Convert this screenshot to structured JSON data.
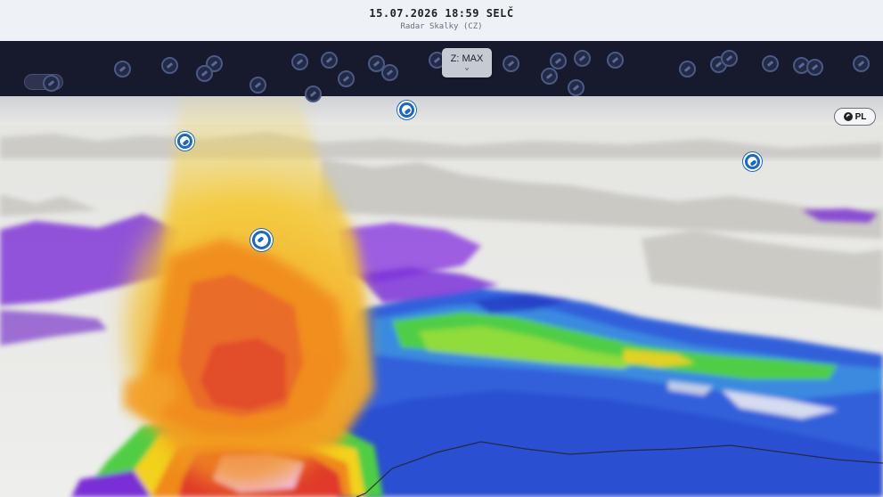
{
  "header": {
    "datetime": "15.07.2026 18:59 SELČ",
    "radar_name": "Radar Skalky (CZ)"
  },
  "controls": {
    "product_label": "Z: MAX",
    "product_chevron": "⌄",
    "country_label": "PL"
  },
  "icons": {
    "radar_marker": "radar-site-icon",
    "chevron": "chevron-down-icon",
    "country": "radar-site-icon"
  },
  "colors": {
    "header_bg": "#eef1f6",
    "strip_bg": "#161a2c",
    "marker_blue": "#1768c9",
    "purple": "#7a2fd6",
    "blue": "#2d5de0",
    "green": "#4fce44",
    "yellow": "#f2d21f",
    "orange": "#f08a1e",
    "red": "#e03a2a"
  }
}
